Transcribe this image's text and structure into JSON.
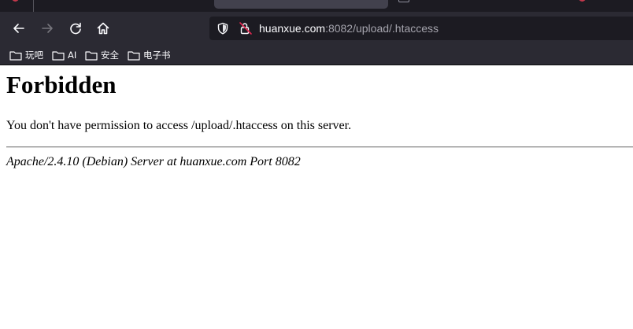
{
  "toolbar": {
    "url_host": "huanxue.com",
    "url_path": ":8082/upload/.htaccess"
  },
  "bookmarks": [
    {
      "label": "玩吧",
      "icon": "folder-icon"
    },
    {
      "label": "AI",
      "icon": "folder-icon"
    },
    {
      "label": "安全",
      "icon": "folder-icon"
    },
    {
      "label": "电子书",
      "icon": "folder-icon"
    }
  ],
  "page": {
    "title": "Forbidden",
    "message": "You don't have permission to access /upload/.htaccess on this server.",
    "signature": "Apache/2.4.10 (Debian) Server at huanxue.com Port 8082"
  },
  "colors": {
    "chrome_bg": "#2b2a33",
    "tabstrip_bg": "#1c1b22",
    "urlbar_bg": "#1c1b22",
    "text_light": "#fbfbfe",
    "text_dim": "#a5a4ad",
    "tab_accent": "#c2384b"
  }
}
